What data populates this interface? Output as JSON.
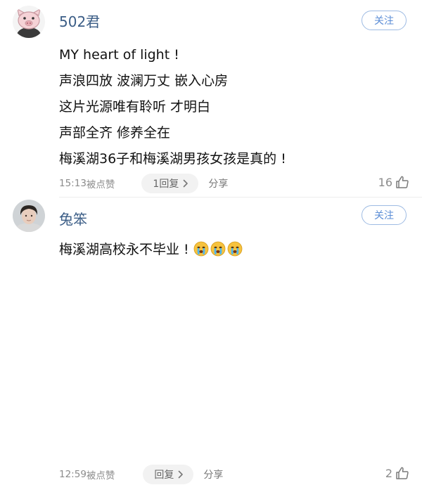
{
  "comments": [
    {
      "username": "502君",
      "follow_label": "关注",
      "lines": [
        "MY heart of light !",
        "声浪四放 波澜万丈 嵌入心房",
        "这片光源唯有聆听 才明白",
        "声部全齐 修养全在",
        "梅溪湖36子和梅溪湖男孩女孩是真的 !"
      ],
      "time": "15:13",
      "liked_by_label": "被点赞",
      "reply_label": "1回复",
      "share_label": "分享",
      "like_count": "16",
      "icons": {
        "avatar": "pig-avatar",
        "reply": "chevron-right-icon",
        "like": "thumbs-up-icon"
      }
    },
    {
      "username": "兔笨",
      "follow_label": "关注",
      "text": "梅溪湖高校永不毕业 !",
      "emojis": [
        "crying-face",
        "crying-face",
        "crying-face"
      ],
      "time": "12:59",
      "liked_by_label": "被点赞",
      "reply_label": "回复",
      "share_label": "分享",
      "like_count": "2",
      "icons": {
        "avatar": "person-photo-avatar",
        "reply": "chevron-right-icon",
        "like": "thumbs-up-icon"
      }
    }
  ],
  "colors": {
    "username": "#3b5d86",
    "follow_border": "#9ebbe3",
    "follow_text": "#5b8dd6",
    "meta_text": "#8c8c8c",
    "pill_bg": "#f2f2f2"
  }
}
